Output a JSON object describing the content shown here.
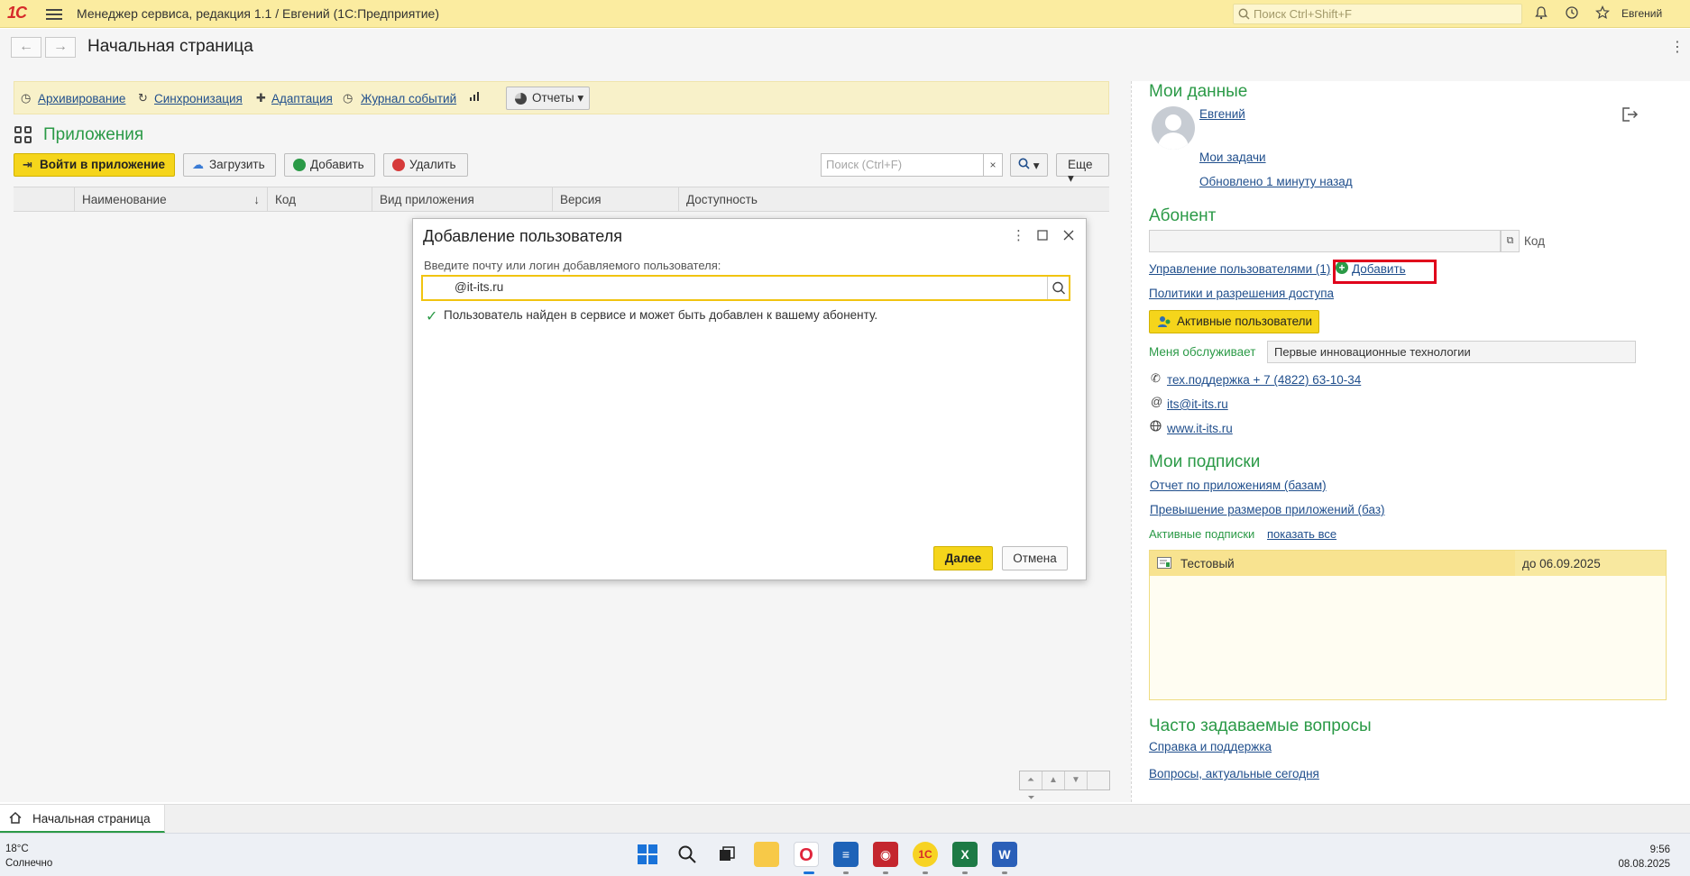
{
  "titlebar": {
    "logo": "1С",
    "title": "Менеджер сервиса, редакция 1.1 / Евгений  (1С:Предприятие)",
    "search_placeholder": "Поиск Ctrl+Shift+F",
    "user": "Евгений"
  },
  "page": {
    "title": "Начальная страница",
    "back": "←",
    "forward": "→"
  },
  "cmdpanel": {
    "archive": "Архивирование",
    "sync": "Синхронизация",
    "adapt": "Адаптация",
    "journal": "Журнал событий",
    "reports": "Отчеты"
  },
  "apps": {
    "title": "Приложения",
    "enter_btn": "Войти в приложение",
    "upload_btn": "Загрузить",
    "add_btn": "Добавить",
    "delete_btn": "Удалить",
    "search_placeholder": "Поиск (Ctrl+F)",
    "clear": "×",
    "more_btn": "Еще",
    "columns": [
      "Наименование",
      "Код",
      "Вид приложения",
      "Версия",
      "Доступность"
    ],
    "sort_arrow": "↓"
  },
  "dialog": {
    "title": "Добавление пользователя",
    "label": "Введите почту или логин добавляемого пользователя:",
    "input_value": "@it-its.ru",
    "found_msg": "Пользователь найден в сервисе и может быть добавлен к вашему абоненту.",
    "next_btn": "Далее",
    "cancel_btn": "Отмена"
  },
  "my_data": {
    "title": "Мои данные",
    "user": "Евгений",
    "tasks": "Мои задачи",
    "updated": "Обновлено 1 минуту назад"
  },
  "subscriber": {
    "title": "Абонент",
    "code_label": "Код",
    "manage_users": "Управление пользователями (1)",
    "add": "Добавить",
    "policies": "Политики и разрешения доступа",
    "active_users_btn": "Активные пользователи",
    "served_by_label": "Меня обслуживает",
    "served_by_value": "Первые инновационные технологии",
    "phone": "тех.поддержка + 7 (4822) 63-10-34",
    "email": "its@it-its.ru",
    "site": "www.it-its.ru"
  },
  "subscriptions": {
    "title": "Мои подписки",
    "report_apps": "Отчет по приложениям (базам)",
    "exceed": "Превышение размеров приложений (баз)",
    "active_label": "Активные подписки",
    "show_all": "показать все",
    "rows": [
      {
        "name": "Тестовый",
        "until": "до 06.09.2025"
      }
    ]
  },
  "faq": {
    "title": "Часто задаваемые вопросы",
    "help": "Справка и поддержка",
    "today": "Вопросы, актуальные сегодня"
  },
  "tabs": {
    "active": "Начальная страница"
  },
  "taskbar": {
    "temp": "18°C",
    "weather": "Солнечно",
    "time": "9:56",
    "date": "08.08.2025"
  },
  "colors": {
    "accent_green": "#2b9a47",
    "yellow_button": "#f5d51b",
    "titlebar": "#fbeca0",
    "highlight_red": "#e0001b"
  }
}
